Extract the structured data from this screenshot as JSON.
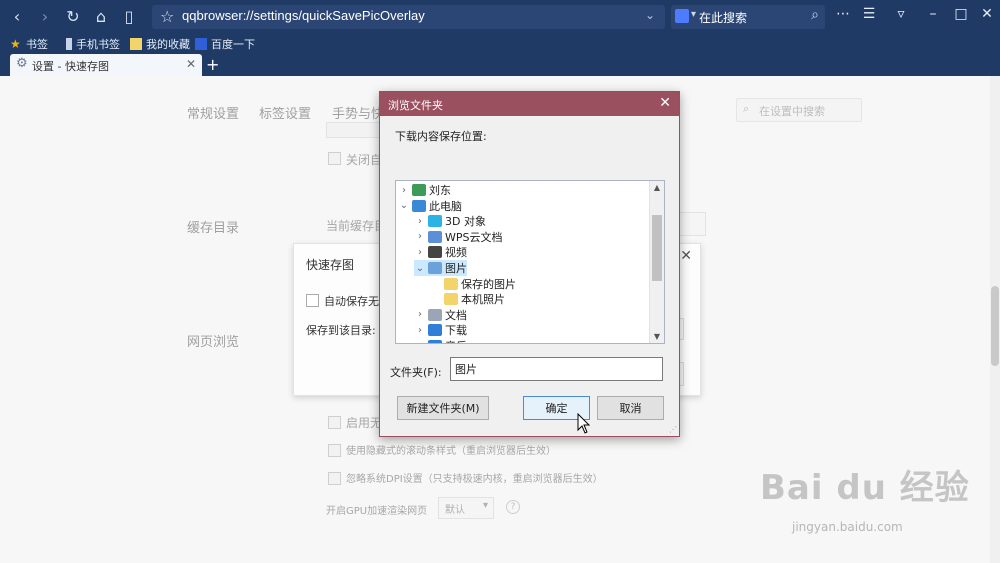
{
  "browser": {
    "url": "qqbrowser://settings/quickSavePicOverlay",
    "search_placeholder": "在此搜索",
    "bookmarks": [
      "书签",
      "手机书签",
      "我的收藏",
      "百度一下"
    ],
    "tab_title": "设置 - 快速存图",
    "new_tab": "+"
  },
  "settings_page": {
    "nav_items": [
      "常规设置",
      "标签设置",
      "手势与快"
    ],
    "search_placeholder": "在设置中搜索",
    "sections": {
      "cache": "缓存目录",
      "web": "网页浏览"
    },
    "options": [
      {
        "label": "关闭自动"
      },
      {
        "label": "启用无"
      },
      {
        "label": "使用隐藏式的滚动条样式（重启浏览器后生效）"
      },
      {
        "label": "忽略系统DPI设置（只支持极速内核，重启浏览器后生效）"
      }
    ],
    "cache_label": "当前缓存目",
    "gpu_label": "开启GPU加速渲染网页",
    "gpu_value": "默认"
  },
  "quick_save_dialog": {
    "title": "快速存图",
    "auto_save_label": "自动保存无提",
    "save_to_label": "保存到该目录:"
  },
  "browse_dialog": {
    "title": "浏览文件夹",
    "prompt": "下载内容保存位置:",
    "tree": [
      {
        "label": "刘东",
        "level": 0,
        "expander": "›",
        "icon": "user-icon",
        "color": "#3e9b57"
      },
      {
        "label": "此电脑",
        "level": 0,
        "expander": "⌄",
        "icon": "computer-icon",
        "color": "#3a89d6"
      },
      {
        "label": "3D 对象",
        "level": 1,
        "expander": "›",
        "icon": "cube-icon",
        "color": "#2bb3e3"
      },
      {
        "label": "WPS云文档",
        "level": 1,
        "expander": "›",
        "icon": "cloud-icon",
        "color": "#5b8fd8"
      },
      {
        "label": "视频",
        "level": 1,
        "expander": "›",
        "icon": "video-icon",
        "color": "#444444"
      },
      {
        "label": "图片",
        "level": 1,
        "expander": "⌄",
        "icon": "pictures-icon",
        "color": "#6aa2d9",
        "selected": true
      },
      {
        "label": "保存的图片",
        "level": 2,
        "expander": "",
        "icon": "folder-icon",
        "color": "#f3d46b"
      },
      {
        "label": "本机照片",
        "level": 2,
        "expander": "",
        "icon": "folder-icon",
        "color": "#f3d46b"
      },
      {
        "label": "文档",
        "level": 1,
        "expander": "›",
        "icon": "document-icon",
        "color": "#9aa6b6"
      },
      {
        "label": "下载",
        "level": 1,
        "expander": "›",
        "icon": "download-icon",
        "color": "#2f7ed8"
      },
      {
        "label": "音乐",
        "level": 1,
        "expander": "›",
        "icon": "music-icon",
        "color": "#2f7ed8"
      }
    ],
    "folder_label": "文件夹(F):",
    "folder_value": "图片",
    "new_folder_button": "新建文件夹(M)",
    "ok_button": "确定",
    "cancel_button": "取消"
  },
  "watermark": {
    "brand": "Bai du 经验",
    "url": "jingyan.baidu.com"
  },
  "colors": {
    "chrome": "#1f3a64",
    "dialog_title": "#9b505f",
    "selection": "#cce8ff"
  }
}
